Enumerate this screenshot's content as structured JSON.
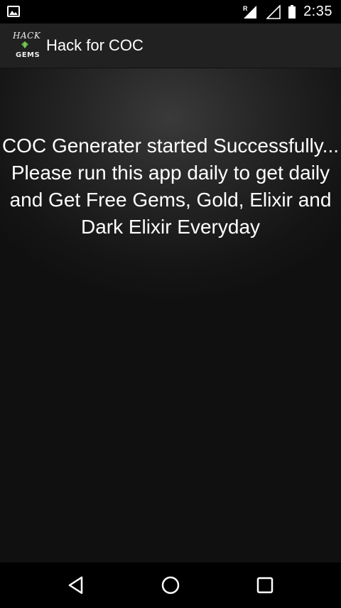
{
  "status_bar": {
    "time": "2:35",
    "icons": [
      "image-notification-icon",
      "signal-roaming-icon",
      "wifi-empty-icon",
      "battery-icon"
    ]
  },
  "action_bar": {
    "title": "Hack for COC",
    "app_icon": {
      "text_top": "HACK",
      "text_bottom": "GEMS",
      "accent": "#4caf50"
    }
  },
  "content": {
    "message": "COC Generater started Successfully... Please run this app daily to get daily and Get Free Gems, Gold, Elixir and Dark Elixir Everyday"
  },
  "nav_bar": {
    "icons": [
      "back-icon",
      "home-icon",
      "recents-icon"
    ]
  }
}
